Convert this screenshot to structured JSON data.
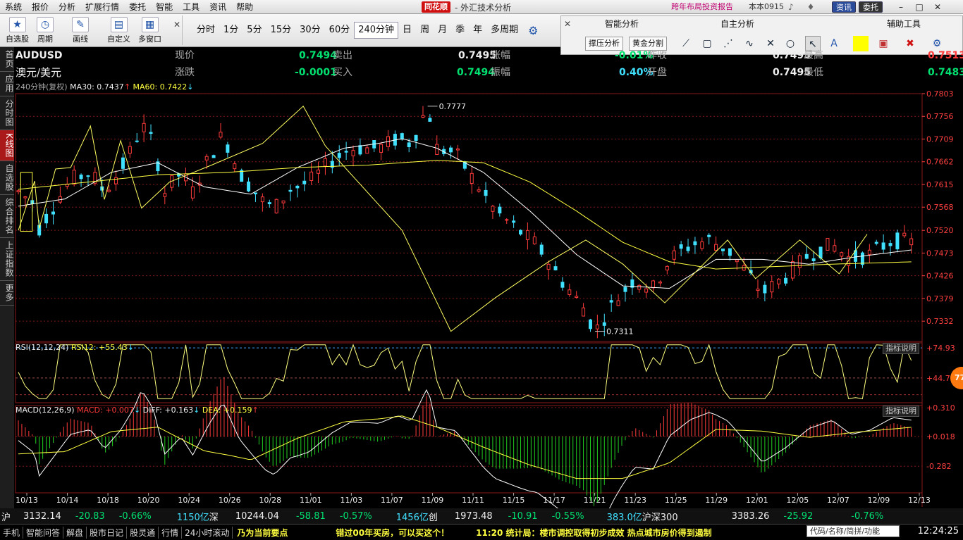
{
  "menu": [
    "系统",
    "报价",
    "分析",
    "扩展行情",
    "委托",
    "智能",
    "工具",
    "资讯",
    "帮助"
  ],
  "brand": {
    "logo": "同花顺",
    "title": "- 外汇技术分析"
  },
  "promo": "跨年布局投资报告",
  "version": "本本0915",
  "top_buttons": {
    "news": "资讯",
    "trade": "委托"
  },
  "toolbar": {
    "tools": [
      {
        "label": "自选股",
        "icon": "star-icon"
      },
      {
        "label": "周期",
        "icon": "clock-icon"
      },
      {
        "label": "画线",
        "icon": "pen-icon"
      },
      {
        "label": "自定义",
        "icon": "layout-icon"
      },
      {
        "label": "多窗口",
        "icon": "windows-icon"
      }
    ],
    "periods": [
      "分时",
      "1分",
      "5分",
      "15分",
      "30分",
      "60分",
      "240分钟",
      "日",
      "周",
      "月",
      "季",
      "年",
      "多周期"
    ],
    "active_period": "240分钟"
  },
  "right_panel": {
    "headers": [
      "智能分析",
      "自主分析",
      "辅助工具"
    ],
    "buttons": [
      "撑压分析",
      "黄金分割"
    ]
  },
  "sidebar": [
    "首页",
    "应用",
    "分时图",
    "K线图",
    "自选股",
    "综合排名",
    "上证指数",
    "更多"
  ],
  "sidebar_active": "K线图",
  "quote": {
    "symbol": "AUDUSD",
    "name": "澳元/美元",
    "labels": {
      "price": "现价",
      "change": "涨跌",
      "sell": "卖出",
      "buy": "买入",
      "pct": "涨幅",
      "amp": "振幅",
      "prev": "昨收",
      "open": "开盘",
      "high": "最高",
      "low": "最低"
    },
    "price": "0.7494",
    "change": "-0.0001",
    "sell": "0.7495",
    "buy": "0.7494",
    "pct": "-0.01%",
    "amp": "0.40%",
    "prev": "0.7495",
    "open": "0.7495",
    "high": "0.7513",
    "low": "0.7483"
  },
  "ma_line": {
    "period": "240分钟(复权)",
    "ma30": "MA30: 0.7437",
    "ma60": "MA60: 0.7422"
  },
  "rsi_line": {
    "label": "RSI(12,12,24)",
    "value": "RSI12: +55.43"
  },
  "macd_line": {
    "label": "MACD(12,26,9)",
    "macd": "MACD: +0.007",
    "diff": "DIFF: +0.163",
    "dea": "DEA: +0.159"
  },
  "indicator_btn": "指标说明",
  "colors": {
    "up": "#ff3b3b",
    "down": "#40e0ff",
    "ma30": "#ffffff",
    "ma60": "#ffff40",
    "grid": "#801818"
  },
  "chart_data": [
    {
      "type": "candlestick",
      "title": "AUDUSD 240分钟",
      "y_ticks": [
        "0.7803",
        "0.7756",
        "0.7709",
        "0.7662",
        "0.7615",
        "0.7568",
        "0.7520",
        "0.7473",
        "0.7426",
        "0.7379",
        "0.7332"
      ],
      "ylim": [
        0.729,
        0.7803
      ],
      "x_ticks": [
        "10/13",
        "10/14",
        "10/18",
        "10/20",
        "10/24",
        "10/26",
        "10/28",
        "11/01",
        "11/03",
        "11/07",
        "11/09",
        "11/11",
        "11/15",
        "11/17",
        "11/21",
        "11/23",
        "11/25",
        "11/29",
        "12/01",
        "12/05",
        "12/07",
        "12/09",
        "12/13"
      ],
      "annotations": [
        {
          "label": "0.7777",
          "value": 0.7777
        },
        {
          "label": "0.7311",
          "value": 0.7311
        }
      ],
      "path_knots": [
        [
          0,
          0.76
        ],
        [
          14,
          0.7575
        ],
        [
          18,
          0.7525
        ],
        [
          45,
          0.7625
        ],
        [
          62,
          0.764
        ],
        [
          74,
          0.76
        ],
        [
          88,
          0.7645
        ],
        [
          100,
          0.77
        ],
        [
          106,
          0.774
        ],
        [
          116,
          0.77
        ],
        [
          126,
          0.76
        ],
        [
          140,
          0.764
        ],
        [
          150,
          0.76
        ],
        [
          164,
          0.767
        ],
        [
          176,
          0.772
        ],
        [
          190,
          0.764
        ],
        [
          200,
          0.761
        ],
        [
          212,
          0.7575
        ],
        [
          220,
          0.7565
        ],
        [
          234,
          0.7605
        ],
        [
          250,
          0.762
        ],
        [
          270,
          0.7665
        ],
        [
          286,
          0.769
        ],
        [
          310,
          0.769
        ],
        [
          326,
          0.771
        ],
        [
          338,
          0.77
        ],
        [
          346,
          0.7745
        ],
        [
          352,
          0.7777
        ],
        [
          360,
          0.769
        ],
        [
          376,
          0.768
        ],
        [
          390,
          0.763
        ],
        [
          410,
          0.756
        ],
        [
          430,
          0.752
        ],
        [
          446,
          0.749
        ],
        [
          466,
          0.742
        ],
        [
          486,
          0.736
        ],
        [
          496,
          0.7311
        ],
        [
          512,
          0.737
        ],
        [
          530,
          0.742
        ],
        [
          546,
          0.74
        ],
        [
          560,
          0.746
        ],
        [
          578,
          0.749
        ],
        [
          594,
          0.75
        ],
        [
          610,
          0.748
        ],
        [
          624,
          0.744
        ],
        [
          640,
          0.739
        ],
        [
          660,
          0.7425
        ],
        [
          680,
          0.747
        ],
        [
          700,
          0.749
        ],
        [
          716,
          0.746
        ],
        [
          732,
          0.747
        ],
        [
          752,
          0.75
        ],
        [
          770,
          0.7495
        ]
      ],
      "zigzag": [
        [
          0,
          0.752
        ],
        [
          14,
          0.7622
        ],
        [
          18,
          0.7524
        ],
        [
          32,
          0.7647
        ],
        [
          45,
          0.765
        ],
        [
          62,
          0.7736
        ],
        [
          74,
          0.7584
        ],
        [
          88,
          0.7706
        ],
        [
          106,
          0.7566
        ],
        [
          130,
          0.762
        ],
        [
          166,
          0.7655
        ],
        [
          210,
          0.77
        ],
        [
          245,
          0.7777
        ],
        [
          264,
          0.7695
        ],
        [
          330,
          0.752
        ],
        [
          372,
          0.7311
        ],
        [
          410,
          0.738
        ],
        [
          456,
          0.7455
        ],
        [
          488,
          0.75
        ],
        [
          520,
          0.745
        ],
        [
          556,
          0.737
        ],
        [
          610,
          0.75
        ],
        [
          634,
          0.742
        ],
        [
          672,
          0.75
        ],
        [
          706,
          0.743
        ],
        [
          730,
          0.7512
        ]
      ],
      "ma30_knots": [
        [
          0,
          0.757
        ],
        [
          40,
          0.7585
        ],
        [
          80,
          0.764
        ],
        [
          120,
          0.766
        ],
        [
          160,
          0.761
        ],
        [
          200,
          0.7595
        ],
        [
          240,
          0.765
        ],
        [
          280,
          0.769
        ],
        [
          310,
          0.77
        ],
        [
          330,
          0.771
        ],
        [
          360,
          0.769
        ],
        [
          400,
          0.764
        ],
        [
          440,
          0.756
        ],
        [
          480,
          0.747
        ],
        [
          520,
          0.7405
        ],
        [
          560,
          0.74
        ],
        [
          600,
          0.746
        ],
        [
          640,
          0.746
        ],
        [
          680,
          0.745
        ],
        [
          720,
          0.7465
        ],
        [
          770,
          0.748
        ]
      ],
      "ma60_knots": [
        [
          0,
          0.7605
        ],
        [
          60,
          0.762
        ],
        [
          120,
          0.7635
        ],
        [
          180,
          0.764
        ],
        [
          240,
          0.765
        ],
        [
          300,
          0.7655
        ],
        [
          360,
          0.7665
        ],
        [
          400,
          0.766
        ],
        [
          440,
          0.762
        ],
        [
          480,
          0.756
        ],
        [
          520,
          0.7495
        ],
        [
          560,
          0.7455
        ],
        [
          600,
          0.744
        ],
        [
          650,
          0.7445
        ],
        [
          700,
          0.745
        ],
        [
          770,
          0.7455
        ]
      ],
      "highlight_box": {
        "x_from": 2,
        "x_to": 12
      }
    },
    {
      "type": "line",
      "title": "RSI(12,12,24)",
      "y_ticks": [
        "+74.93",
        "+44.78"
      ],
      "ylim": [
        20,
        80
      ]
    },
    {
      "type": "histogram",
      "title": "MACD(12,26,9)",
      "y_ticks": [
        "+0.310",
        "+0.018",
        "-0.282"
      ],
      "ylim": [
        -0.55,
        0.33
      ]
    }
  ],
  "status": {
    "sh": {
      "label": "沪",
      "val": "3132.14",
      "chg": "-20.83",
      "pct": "-0.66%",
      "amt": "1150亿"
    },
    "sz": {
      "label": "深",
      "val": "10244.04",
      "chg": "-58.81",
      "pct": "-0.57%",
      "amt": "1456亿"
    },
    "cy": {
      "label": "创",
      "val": "1973.48",
      "chg": "-10.91",
      "pct": "-0.55%",
      "amt": "383.0亿"
    },
    "hs": {
      "label": "沪深300",
      "val": "3383.26",
      "chg": "-25.92",
      "pct": "-0.76%"
    },
    "tabs": [
      "手机",
      "智能问答",
      "解盘",
      "股市日记",
      "股灵通",
      "行情",
      "24小时滚动"
    ],
    "news": [
      "乃为当前要点",
      "错过00年买房，可以买这个！",
      "11:20 统计局：楼市调控取得初步成效 热点城市房价得到遏制"
    ],
    "search_placeholder": "代码/名称/简拼/功能",
    "clock": "12:24:25"
  },
  "bubble": "77"
}
